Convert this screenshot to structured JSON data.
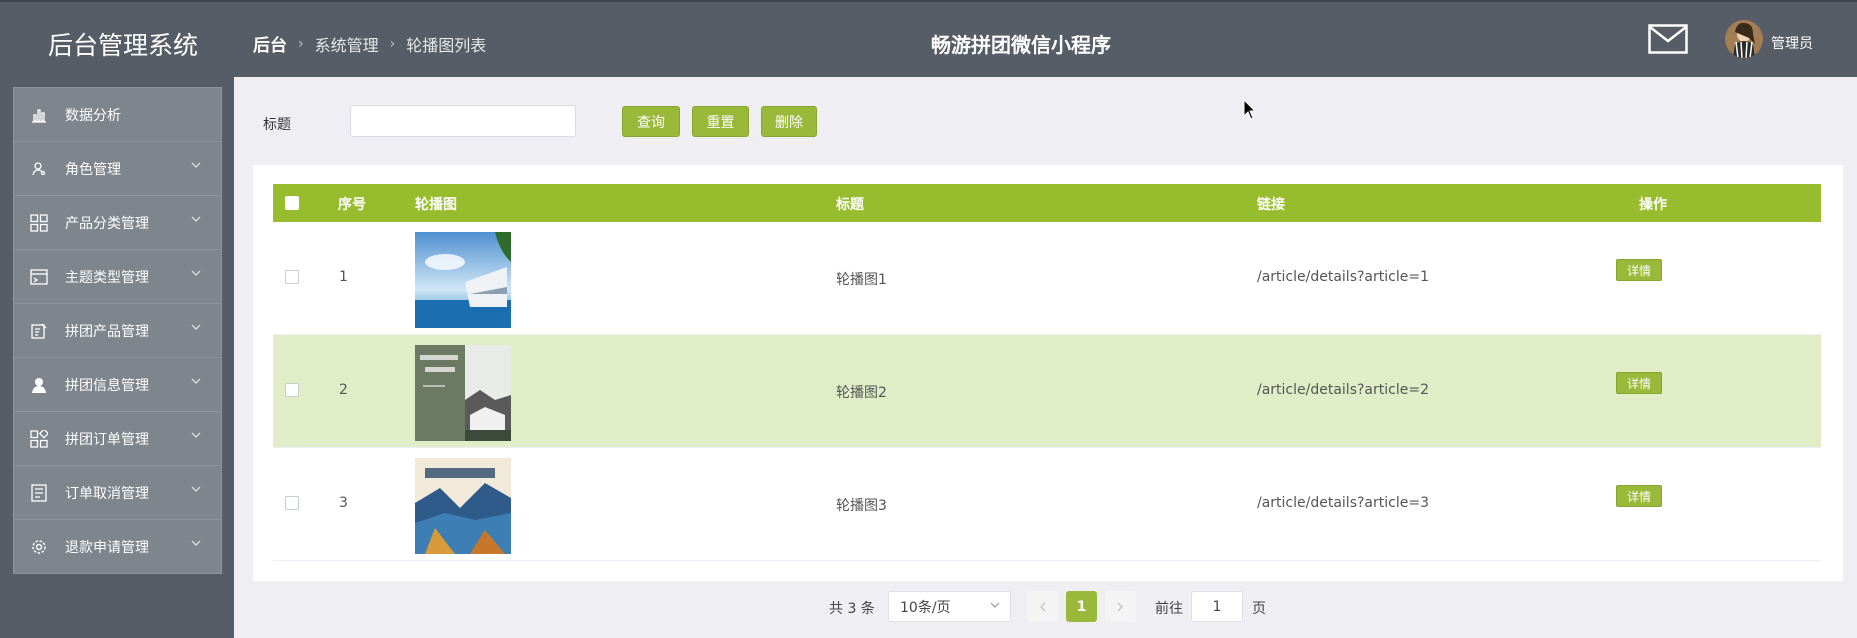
{
  "header": {
    "logo": "后台管理系统",
    "breadcrumb": [
      "后台",
      "系统管理",
      "轮播图列表"
    ],
    "app_title": "畅游拼团微信小程序",
    "user_name": "管理员"
  },
  "sidebar": {
    "items": [
      {
        "label": "数据分析",
        "icon": "bar-chart-icon",
        "expandable": false
      },
      {
        "label": "角色管理",
        "icon": "user-icon",
        "expandable": true
      },
      {
        "label": "产品分类管理",
        "icon": "grid-icon",
        "expandable": true
      },
      {
        "label": "主题类型管理",
        "icon": "window-icon",
        "expandable": true
      },
      {
        "label": "拼团产品管理",
        "icon": "edit-icon",
        "expandable": true
      },
      {
        "label": "拼团信息管理",
        "icon": "person-icon",
        "expandable": true
      },
      {
        "label": "拼团订单管理",
        "icon": "apps-icon",
        "expandable": true
      },
      {
        "label": "订单取消管理",
        "icon": "list-icon",
        "expandable": true
      },
      {
        "label": "退款申请管理",
        "icon": "gear-icon",
        "expandable": true
      }
    ]
  },
  "search": {
    "label": "标题",
    "value": "",
    "placeholder": "",
    "query_btn": "查询",
    "reset_btn": "重置",
    "delete_btn": "删除"
  },
  "table": {
    "columns": [
      "序号",
      "轮播图",
      "标题",
      "链接",
      "操作"
    ],
    "rows": [
      {
        "no": "1",
        "title": "轮播图1",
        "link": "/article/details?article=1",
        "action": "详情"
      },
      {
        "no": "2",
        "title": "轮播图2",
        "link": "/article/details?article=2",
        "action": "详情"
      },
      {
        "no": "3",
        "title": "轮播图3",
        "link": "/article/details?article=3",
        "action": "详情"
      }
    ]
  },
  "pagination": {
    "total": "共 3 条",
    "page_size": "10条/页",
    "current": "1",
    "goto_label": "前往",
    "goto_value": "1",
    "page_suffix": "页"
  },
  "colors": {
    "header_bg": "#565d66",
    "accent": "#9ab93a",
    "sidebar_item": "#7e858d",
    "row_highlight": "#e0edc6"
  }
}
